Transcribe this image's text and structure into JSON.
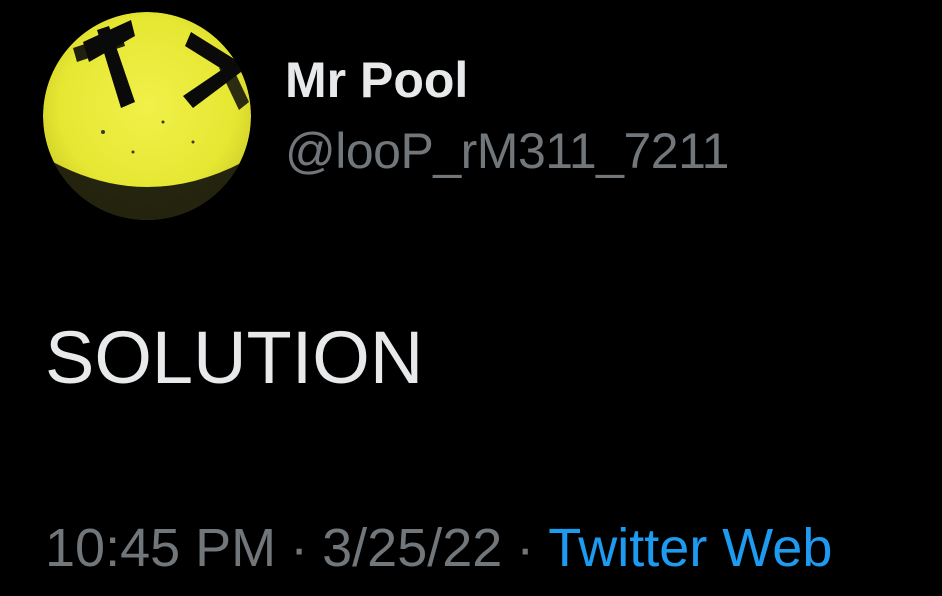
{
  "tweet": {
    "author": {
      "display_name": "Mr Pool",
      "handle": "@looP_rM311_7211",
      "avatar_icon": "smiley-avatar-icon"
    },
    "text": "SOLUTION",
    "meta": {
      "time": "10:45 PM",
      "separator": "·",
      "date": "3/25/22",
      "source": "Twitter Web"
    }
  },
  "colors": {
    "background": "#000000",
    "primary_text": "#e7e9ea",
    "secondary_text": "#71767b",
    "accent": "#1d9bf0",
    "avatar_yellow": "#e9ea35"
  }
}
